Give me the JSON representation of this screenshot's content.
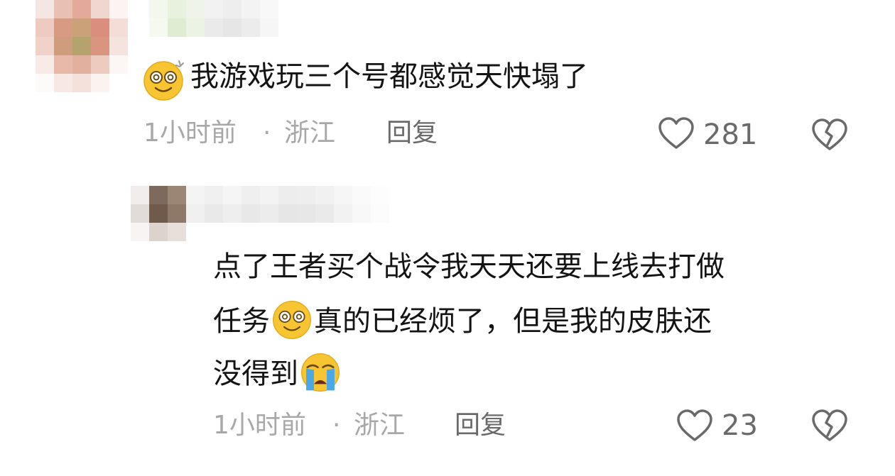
{
  "comments": [
    {
      "emoji": "dizzy-face",
      "text": "我游戏玩三个号都感觉天快塌了",
      "time": "1小时前",
      "separator": "·",
      "location": "浙江",
      "reply_label": "回复",
      "likes": "281"
    },
    {
      "lines": [
        {
          "before": "点了王者买个战令我天天还要上线去打做",
          "emoji": "",
          "after": ""
        },
        {
          "before": "任务",
          "emoji": "dizzy-face",
          "after": "真的已经烦了，但是我的皮肤还"
        },
        {
          "before": "没得到",
          "emoji": "crying-face",
          "after": ""
        }
      ],
      "time": "1小时前",
      "separator": "·",
      "location": "浙江",
      "reply_label": "回复",
      "likes": "23"
    }
  ],
  "colors": {
    "text": "#141414",
    "meta": "#a8a8a8",
    "action": "#6a6a6a",
    "emoji_face": "#f7c531"
  }
}
